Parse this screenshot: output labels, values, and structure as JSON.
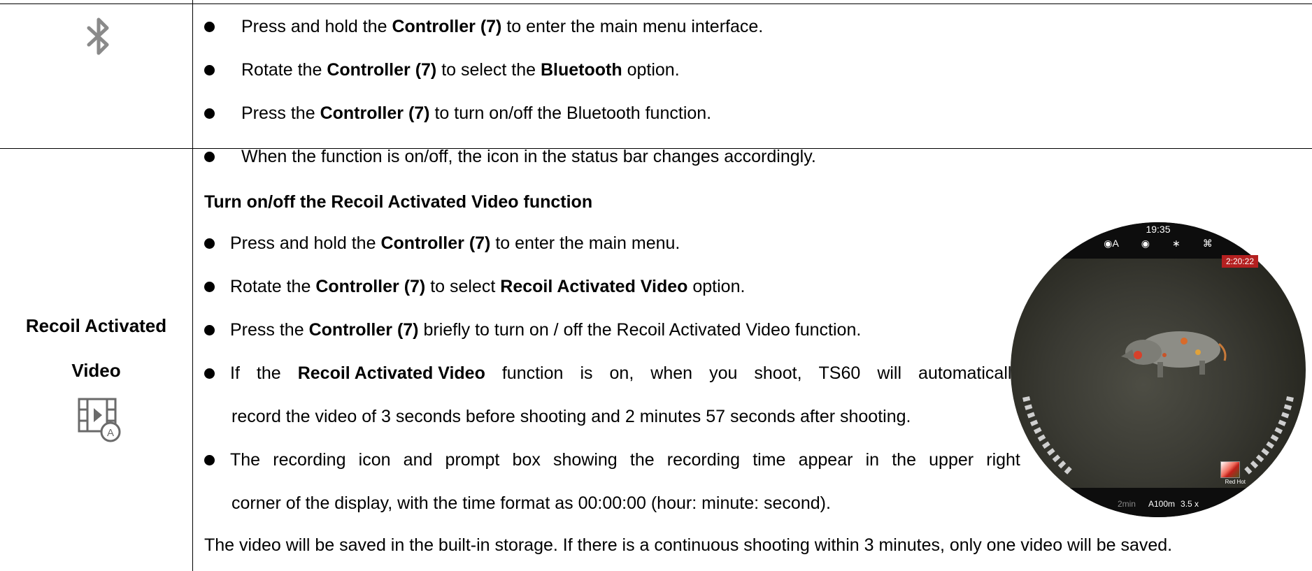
{
  "bluetooth_row": {
    "icon": "bluetooth-icon",
    "bullets": [
      {
        "pre": "Press and hold the ",
        "bold1": "Controller (7)",
        "mid": " to enter the main menu interface.",
        "bold2": "",
        "post": ""
      },
      {
        "pre": "Rotate the ",
        "bold1": "Controller (7)",
        "mid": " to select the ",
        "bold2": "Bluetooth",
        "post": " option."
      },
      {
        "pre": "Press the ",
        "bold1": "Controller (7)",
        "mid": " to turn on/off the Bluetooth function.",
        "bold2": "",
        "post": ""
      },
      {
        "pre": "When the function is on/off, the icon in the status bar changes accordingly.",
        "bold1": "",
        "mid": "",
        "bold2": "",
        "post": ""
      }
    ]
  },
  "recoil_row": {
    "label_line1": "Recoil Activated",
    "label_line2": "Video",
    "icon": "video-auto-icon",
    "heading": "Turn on/off the Recoil Activated Video function",
    "b1": {
      "pre": "Press and hold the ",
      "bold1": "Controller (7)",
      "post": " to enter the main menu."
    },
    "b2": {
      "pre": "Rotate the ",
      "bold1": "Controller (7)",
      "mid": " to select ",
      "bold2": "Recoil Activated Video",
      "post": " option."
    },
    "b3": {
      "pre": "Press the ",
      "bold1": "Controller (7)",
      "post": " briefly to turn on / off the Recoil Activated Video function."
    },
    "b4": {
      "words": [
        "If",
        "the",
        "Recoil Activated Video",
        "function",
        "is",
        "on,",
        "when",
        "you",
        "shoot,",
        "TS60",
        "will",
        "automatically"
      ],
      "cont": "record the video of 3 seconds before shooting and 2 minutes 57 seconds after shooting."
    },
    "b5": {
      "words": [
        "The",
        "recording",
        "icon",
        "and",
        "prompt",
        "box",
        "showing",
        "the",
        "recording",
        "time",
        "appear",
        "in",
        "the",
        "upper",
        "right"
      ],
      "cont": "corner of the display, with the time format as 00:00:00 (hour: minute: second)."
    },
    "footer": "The video will be saved in the built-in storage. If there is a continuous shooting within 3 minutes, only one video will be saved."
  },
  "scope_image": {
    "time": "19:35",
    "status_icons": [
      "auto-shutter-icon",
      "eye-icon",
      "bluetooth-icon",
      "wifi-icon"
    ],
    "status_a": "A",
    "recording_time": "2:20:22",
    "auto_off": "2min",
    "rangefinder": "A100m",
    "zoom": "3.5 x",
    "palette": "Red Hot",
    "colors": {
      "recording_badge": "#b42020",
      "bar": "#0d0d0d"
    }
  }
}
